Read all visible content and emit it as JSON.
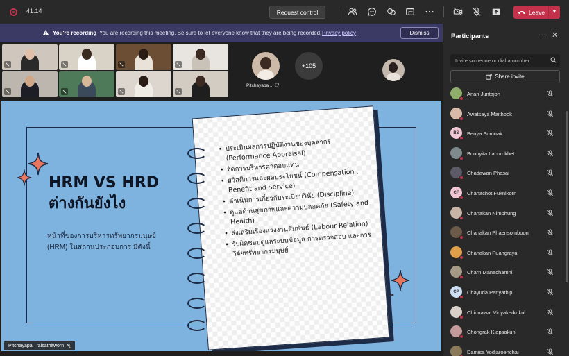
{
  "topbar": {
    "timer": "41:14",
    "request_control_label": "Request control",
    "leave_label": "Leave",
    "icons": [
      "record-icon",
      "people-icon",
      "chat-icon",
      "reactions-icon",
      "rooms-icon",
      "more-icon",
      "camera-off-icon",
      "mic-off-icon",
      "share-tray-icon",
      "phone-icon",
      "chevron-down-icon"
    ]
  },
  "banner": {
    "bold_text": "You're recording",
    "message": "You are recording this meeting. Be sure to let everyone know that they are being recorded.",
    "link_text": "Privacy policy",
    "dismiss_label": "Dismiss"
  },
  "videos": {
    "extra_count": "+105",
    "featured_name": "Pitchayapa ...",
    "tile_count": 8
  },
  "slide": {
    "title_line1": "HRM VS HRD",
    "title_line2": "ต่างกันยังไง",
    "subtitle_line1": "หน้าที่ของการบริหารทรัพยากรมนุษย์",
    "subtitle_line2": "(HRM) ในสถานประกอบการ  มีดังนี้",
    "items": [
      "ประเมินผลการปฏิบัติงานของบุคลากร (Performance Appraisal)",
      "จัดการบริหารค่าตอบแทน",
      "สวัสดิการและผลประโยชน์ (Compensation , Benefit and Service)",
      "ดำเนินการเกี่ยวกับระเบียบวินัย (Discipline)",
      "ดูแลด้านสุขภาพและความปลอดภัย (Safety and Health)",
      "ส่งเสริมเรื่องแรงงานสัมพันธ์ (Labour Relation)",
      "รับผิดชอบดูแลระบบข้อมูล การตรวจสอบ และการวิจัยทรัพยากรมนุษย์"
    ]
  },
  "presenter_tag": "Pitchayapa Traisathitworn",
  "panel": {
    "title": "Participants",
    "invite_placeholder": "Invite someone or dial a number",
    "share_invite_label": "Share invite",
    "participants": [
      {
        "name": "Anan Juntajon",
        "initials": "",
        "color": "#8fae6b"
      },
      {
        "name": "Awatsaya Maithook",
        "initials": "",
        "color": "#d9b9a7"
      },
      {
        "name": "Benya Somnak",
        "initials": "BS",
        "color": "#f2c6d4"
      },
      {
        "name": "Boonyita Lacornkhet",
        "initials": "",
        "color": "#7e8a8c"
      },
      {
        "name": "Chadawan Phasai",
        "initials": "",
        "color": "#5c5a66"
      },
      {
        "name": "Chanachot Fuknikorn",
        "initials": "CF",
        "color": "#f2c6d4"
      },
      {
        "name": "Chanakan Nimphung",
        "initials": "",
        "color": "#c9b5a8"
      },
      {
        "name": "Chanakan Phaensomboon",
        "initials": "",
        "color": "#6b5a48"
      },
      {
        "name": "Chanakan Puangraya",
        "initials": "",
        "color": "#e0a04a"
      },
      {
        "name": "Charn Manachamni",
        "initials": "",
        "color": "#a59a86"
      },
      {
        "name": "Chayuda Panyathip",
        "initials": "CP",
        "color": "#cfe0f5"
      },
      {
        "name": "Chinnawat Viriyakerkrikul",
        "initials": "",
        "color": "#d8d0c8"
      },
      {
        "name": "Chongrak Klapsakun",
        "initials": "",
        "color": "#c49a9a"
      },
      {
        "name": "Damisa Yodjaroenchai",
        "initials": "",
        "color": "#8a7a5a"
      }
    ]
  }
}
